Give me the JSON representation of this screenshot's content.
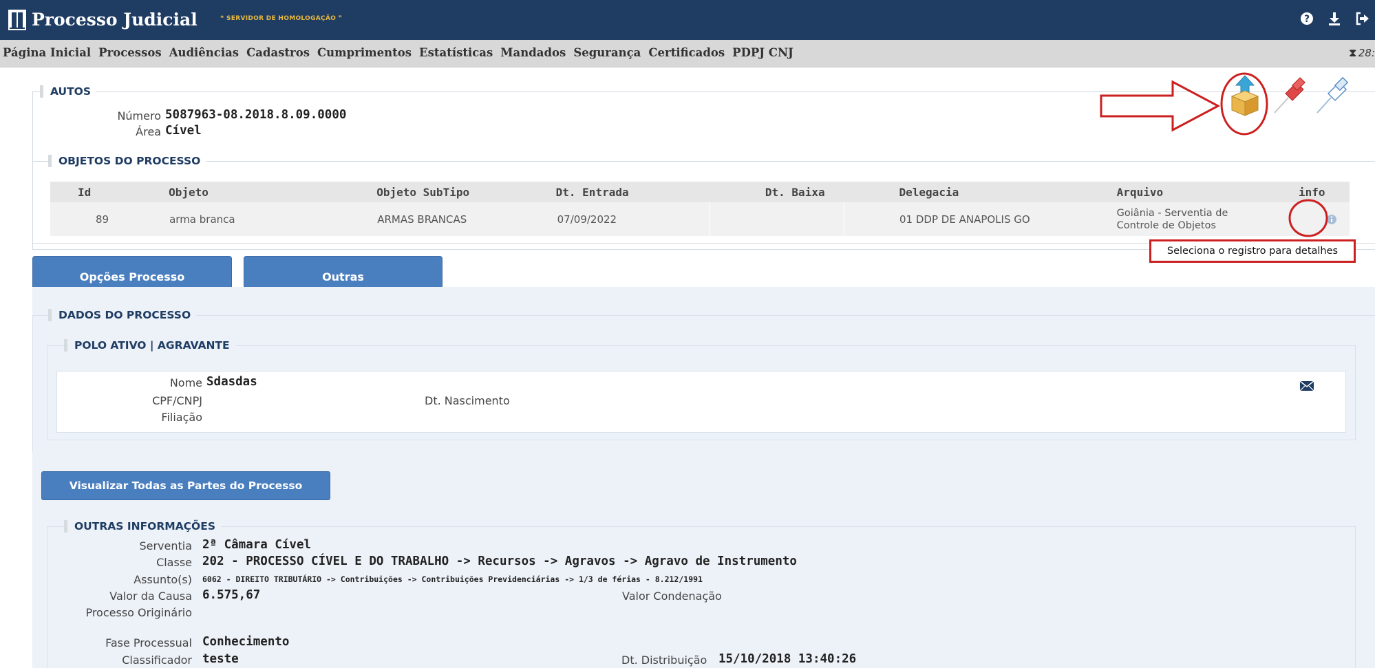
{
  "header": {
    "title": "Processo Judicial",
    "server_tag": "❝ SERVIDOR DE HOMOLOGAÇÃO ❞",
    "icons": [
      "help-icon",
      "download-icon",
      "logout-icon"
    ]
  },
  "menu": {
    "items": [
      "Página Inicial",
      "Processos",
      "Audiências",
      "Cadastros",
      "Cumprimentos",
      "Estatísticas",
      "Mandados",
      "Segurança",
      "Certificados",
      "PDPJ CNJ"
    ],
    "timer": "28:"
  },
  "autos": {
    "legend": "AUTOS",
    "numero_label": "Número",
    "numero": "5087963-08.2018.8.09.0000",
    "area_label": "Área",
    "area": "Cível",
    "action_icons": [
      "package-upload-icon",
      "red-pin-icon",
      "blue-pin-icon"
    ]
  },
  "objetos": {
    "legend": "OBJETOS DO PROCESSO",
    "columns": [
      "Id",
      "Objeto",
      "Objeto SubTipo",
      "Dt. Entrada",
      "Dt. Baixa",
      "Delegacia",
      "Arquivo",
      "info"
    ],
    "rows": [
      {
        "id": "89",
        "objeto": "arma branca",
        "subtipo": "ARMAS BRANCAS",
        "entrada": "07/09/2022",
        "baixa": "",
        "delegacia": "01 DDP DE ANAPOLIS GO",
        "arquivo_line1": "Goiânia - Serventia de",
        "arquivo_line2": "Controle de Objetos"
      }
    ],
    "tooltip": "Seleciona o registro para detalhes"
  },
  "buttons": {
    "opcoes": "Opções Processo",
    "outras": "Outras",
    "visualizar": "Visualizar Todas as Partes do Processo"
  },
  "dados": {
    "legend": "DADOS DO PROCESSO",
    "polo_legend": "POLO ATIVO | AGRAVANTE",
    "nome_label": "Nome",
    "nome": "Sdasdas",
    "cpf_label": "CPF/CNPJ",
    "nascimento_label": "Dt. Nascimento",
    "filiacao_label": "Filiação"
  },
  "outras": {
    "legend": "OUTRAS INFORMAÇÕES",
    "serventia_label": "Serventia",
    "serventia": "2ª Câmara Cível",
    "classe_label": "Classe",
    "classe": "202 - PROCESSO CÍVEL E DO TRABALHO -> Recursos -> Agravos -> Agravo de Instrumento",
    "assunto_label": "Assunto(s)",
    "assunto": "6062 - DIREITO TRIBUTÁRIO -> Contribuições -> Contribuições Previdenciárias -> 1/3 de férias - 8.212/1991",
    "valor_causa_label": "Valor da Causa",
    "valor_causa": "6.575,67",
    "valor_condenacao_label": "Valor Condenação",
    "originario_label": "Processo Originário",
    "fase_label": "Fase Processual",
    "fase": "Conhecimento",
    "classificador_label": "Classificador",
    "classificador": "teste",
    "distribuicao_label": "Dt. Distribuição",
    "distribuicao": "15/10/2018 13:40:26"
  },
  "colors": {
    "header_bg": "#1f3c63",
    "menu_bg": "#d8d8d8",
    "button_bg": "#4a7fbf",
    "annotation_red": "#cc1f1f",
    "server_tag": "#e9b93c"
  }
}
